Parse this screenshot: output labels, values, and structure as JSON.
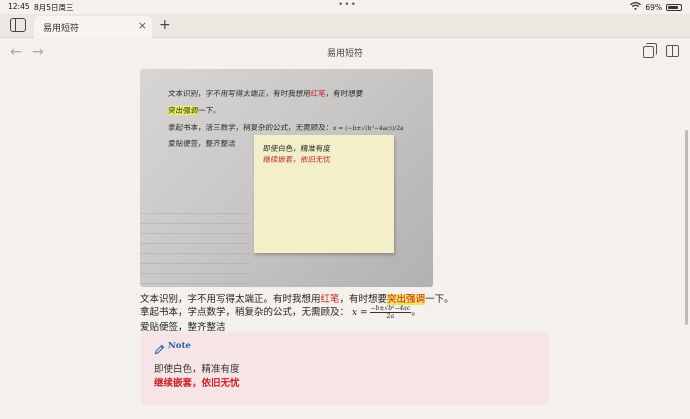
{
  "status": {
    "time": "12:45",
    "date": "8月5日周三",
    "battery": "69%",
    "battery_level": 0.69
  },
  "tab": {
    "label": "易用短符"
  },
  "page": {
    "title": "易用短符"
  },
  "photo": {
    "hw1": "文本识别，字不用写得太端正，有时我想用",
    "hw1_red": "红笔",
    "hw1_end": "，有时想要",
    "hw2_hl": "突出强调",
    "hw2_end": "一下。",
    "hw3": "拿起书本，活三数学，稍复杂的公式，无需顾及：",
    "hw3_math": "x = (−b±√(b²−4ac))/2a",
    "hw4": "爱贴便签，整齐整洁",
    "sticky1": "即使白色，精准有度",
    "sticky2": "继续嵌套，依旧无忧"
  },
  "text": {
    "l1a": "文本识别，字不用写得太端正。有时我想用",
    "l1_red": "红笔",
    "l1b": "，有时想要",
    "l1_hl": "突出强调",
    "l1c": "一下。",
    "l2": "拿起书本，学点数学，稍复杂的公式，无需顾及：",
    "math_lhs": "x =",
    "math_num": "−b±√b²−4ac",
    "math_den": "2a",
    "l2_end": "。",
    "l3": "爱贴便签，整齐整洁"
  },
  "note": {
    "title": "Note",
    "line1": "即使白色，精准有度",
    "line2": "继续嵌套，依旧无忧"
  }
}
